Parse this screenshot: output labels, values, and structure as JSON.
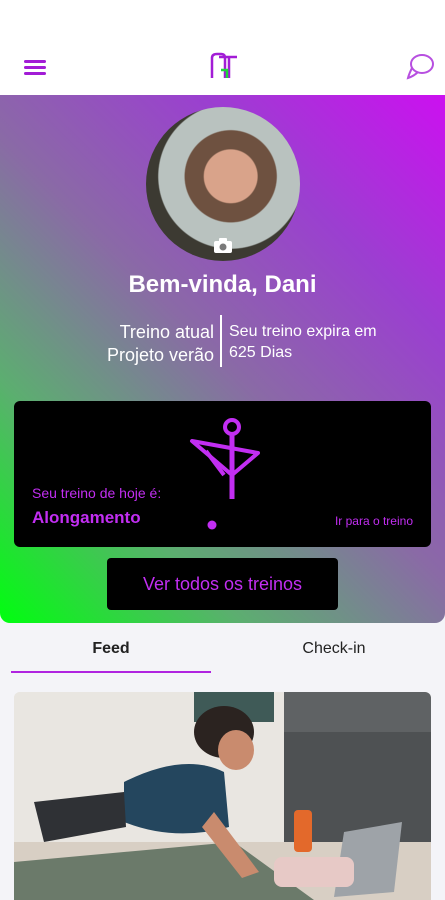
{
  "header": {
    "menu_icon": "hamburger-menu-icon",
    "logo_icon": "app-logo",
    "chat_icon": "chat-bubble-icon"
  },
  "colors": {
    "accent": "#c22ef2",
    "gradient_start": "#cc10f0",
    "gradient_end": "#00ff0f",
    "card_bg": "#000000"
  },
  "profile": {
    "welcome": "Bem-vinda, Dani",
    "camera_icon": "camera-icon",
    "current_workout_label": "Treino atual",
    "current_workout_name": "Projeto verão",
    "expiry_label": "Seu treino expira em",
    "expiry_value": "625 Dias"
  },
  "today": {
    "label": "Seu treino de hoje é:",
    "name": "Alongamento",
    "link": "Ir para o treino",
    "icon": "stretching-figure-icon"
  },
  "buttons": {
    "all_workouts": "Ver todos os treinos"
  },
  "tabs": [
    {
      "label": "Feed",
      "active": true
    },
    {
      "label": "Check-in",
      "active": false
    }
  ]
}
